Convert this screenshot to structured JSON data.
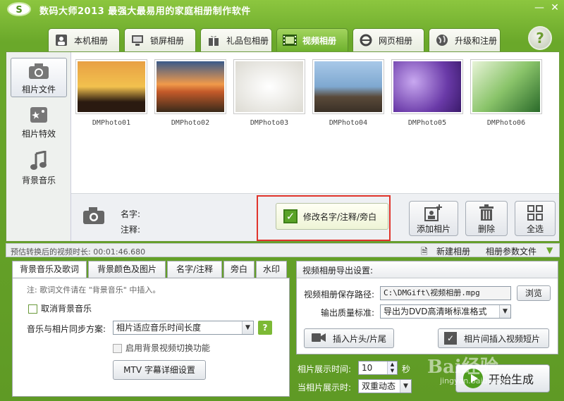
{
  "app": {
    "title": "数码大师2013  最强大最易用的家庭相册制作软件",
    "logo": "S"
  },
  "window": {
    "minimize": "—",
    "close": "✕"
  },
  "tabs": [
    {
      "label": "本机相册",
      "icon": "user-photo-icon"
    },
    {
      "label": "锁屏相册",
      "icon": "monitor-icon"
    },
    {
      "label": "礼品包相册",
      "icon": "gift-icon"
    },
    {
      "label": "视频相册",
      "icon": "film-icon"
    },
    {
      "label": "网页相册",
      "icon": "ie-icon"
    },
    {
      "label": "升级和注册",
      "icon": "globe-icon"
    }
  ],
  "help": "?",
  "sidebar": [
    {
      "label": "相片文件",
      "icon": "camera-icon"
    },
    {
      "label": "相片特效",
      "icon": "effects-icon"
    },
    {
      "label": "背景音乐",
      "icon": "music-note-icon"
    }
  ],
  "photos": [
    "DMPhoto01",
    "DMPhoto02",
    "DMPhoto03",
    "DMPhoto04",
    "DMPhoto05",
    "DMPhoto06"
  ],
  "info": {
    "name_label": "名字:",
    "note_label": "注释:",
    "edit_button": "修改名字/注释/旁白"
  },
  "actions": {
    "add": "添加相片",
    "delete": "删除",
    "select_all": "全选"
  },
  "status": {
    "estimate": "预估转换后的视频时长: 00:01:46.680",
    "new_album": "新建相册",
    "album_params": "相册参数文件"
  },
  "left_tabs": [
    "背景音乐及歌词",
    "背景颜色及图片",
    "名字/注释",
    "旁白",
    "水印"
  ],
  "music": {
    "note": "注: 歌词文件请在 \"背景音乐\" 中插入。",
    "cancel_bg": "取消背景音乐",
    "sync_label": "音乐与相片同步方案:",
    "sync_value": "相片适应音乐时间长度",
    "video_switch": "启用背景视频切换功能",
    "mtv_button": "MTV  字幕详细设置"
  },
  "export": {
    "header": "视频相册导出设置:",
    "path_label": "视频相册保存路径:",
    "path_value": "C:\\DMGift\\视频相册.mpg",
    "browse": "浏览",
    "quality_label": "输出质量标准:",
    "quality_value": "导出为DVD高清晰标准格式",
    "insert_head": "插入片头/片尾",
    "insert_clip": "相片间插入视频短片"
  },
  "timing": {
    "show_label": "相片展示时间:",
    "show_value": "10",
    "unit": "秒",
    "transition_label": "当相片展示时:",
    "transition_value": "双重动态"
  },
  "generate": "开始生成",
  "watermark": {
    "text": "Bai经验",
    "url": "jingyan.baidu.com"
  }
}
